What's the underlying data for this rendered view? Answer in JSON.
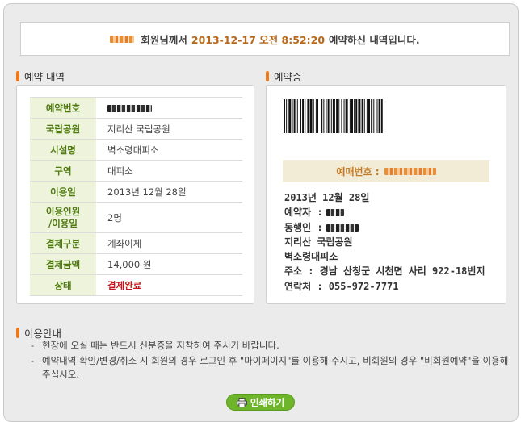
{
  "banner": {
    "text_suffix": "회원님께서",
    "datetime": "2013-12-17 오전 8:52:20",
    "tail": "예약하신 내역입니다."
  },
  "reservation": {
    "title": "예약 내역",
    "rows": [
      {
        "label": "예약번호",
        "value": ""
      },
      {
        "label": "국립공원",
        "value": "지리산 국립공원"
      },
      {
        "label": "시설명",
        "value": "벽소령대피소"
      },
      {
        "label": "구역",
        "value": "대피소"
      },
      {
        "label": "이용일",
        "value": "2013년 12월 28일"
      },
      {
        "label": "이용인원\n/이용일",
        "value": "2명"
      },
      {
        "label": "결제구분",
        "value": "계좌이체"
      },
      {
        "label": "결제금액",
        "value": "14,000 원"
      },
      {
        "label": "상태",
        "value": "결제완료"
      }
    ]
  },
  "ticket": {
    "title": "예약증",
    "number_label": "예매번호 :",
    "date": "2013년 12월 28일",
    "booker_label": "예약자 :",
    "companion_label": "동행인 :",
    "park": "지리산 국립공원",
    "facility": "벽소령대피소",
    "address": "주소 : 경남 산청군 시천면 사리 922-18번지",
    "phone": "연락처 : 055-972-7771"
  },
  "guide": {
    "title": "이용안내",
    "lines": [
      "현장에 오실 때는 반드시 신분증을 지참하여 주시기 바랍니다.",
      "예약내역 확인/변경/취소 시 회원의 경우 로그인 후 \"마이페이지\"를 이용해 주시고, 비회원의 경우 \"비회원예약\"을 이용해 주십시오."
    ]
  },
  "print_button": {
    "label": "인쇄하기"
  },
  "colors": {
    "accent": "#ee7a1e",
    "label_bg": "#eef3dc",
    "status": "#c8141a",
    "button": "#6fb52c"
  }
}
